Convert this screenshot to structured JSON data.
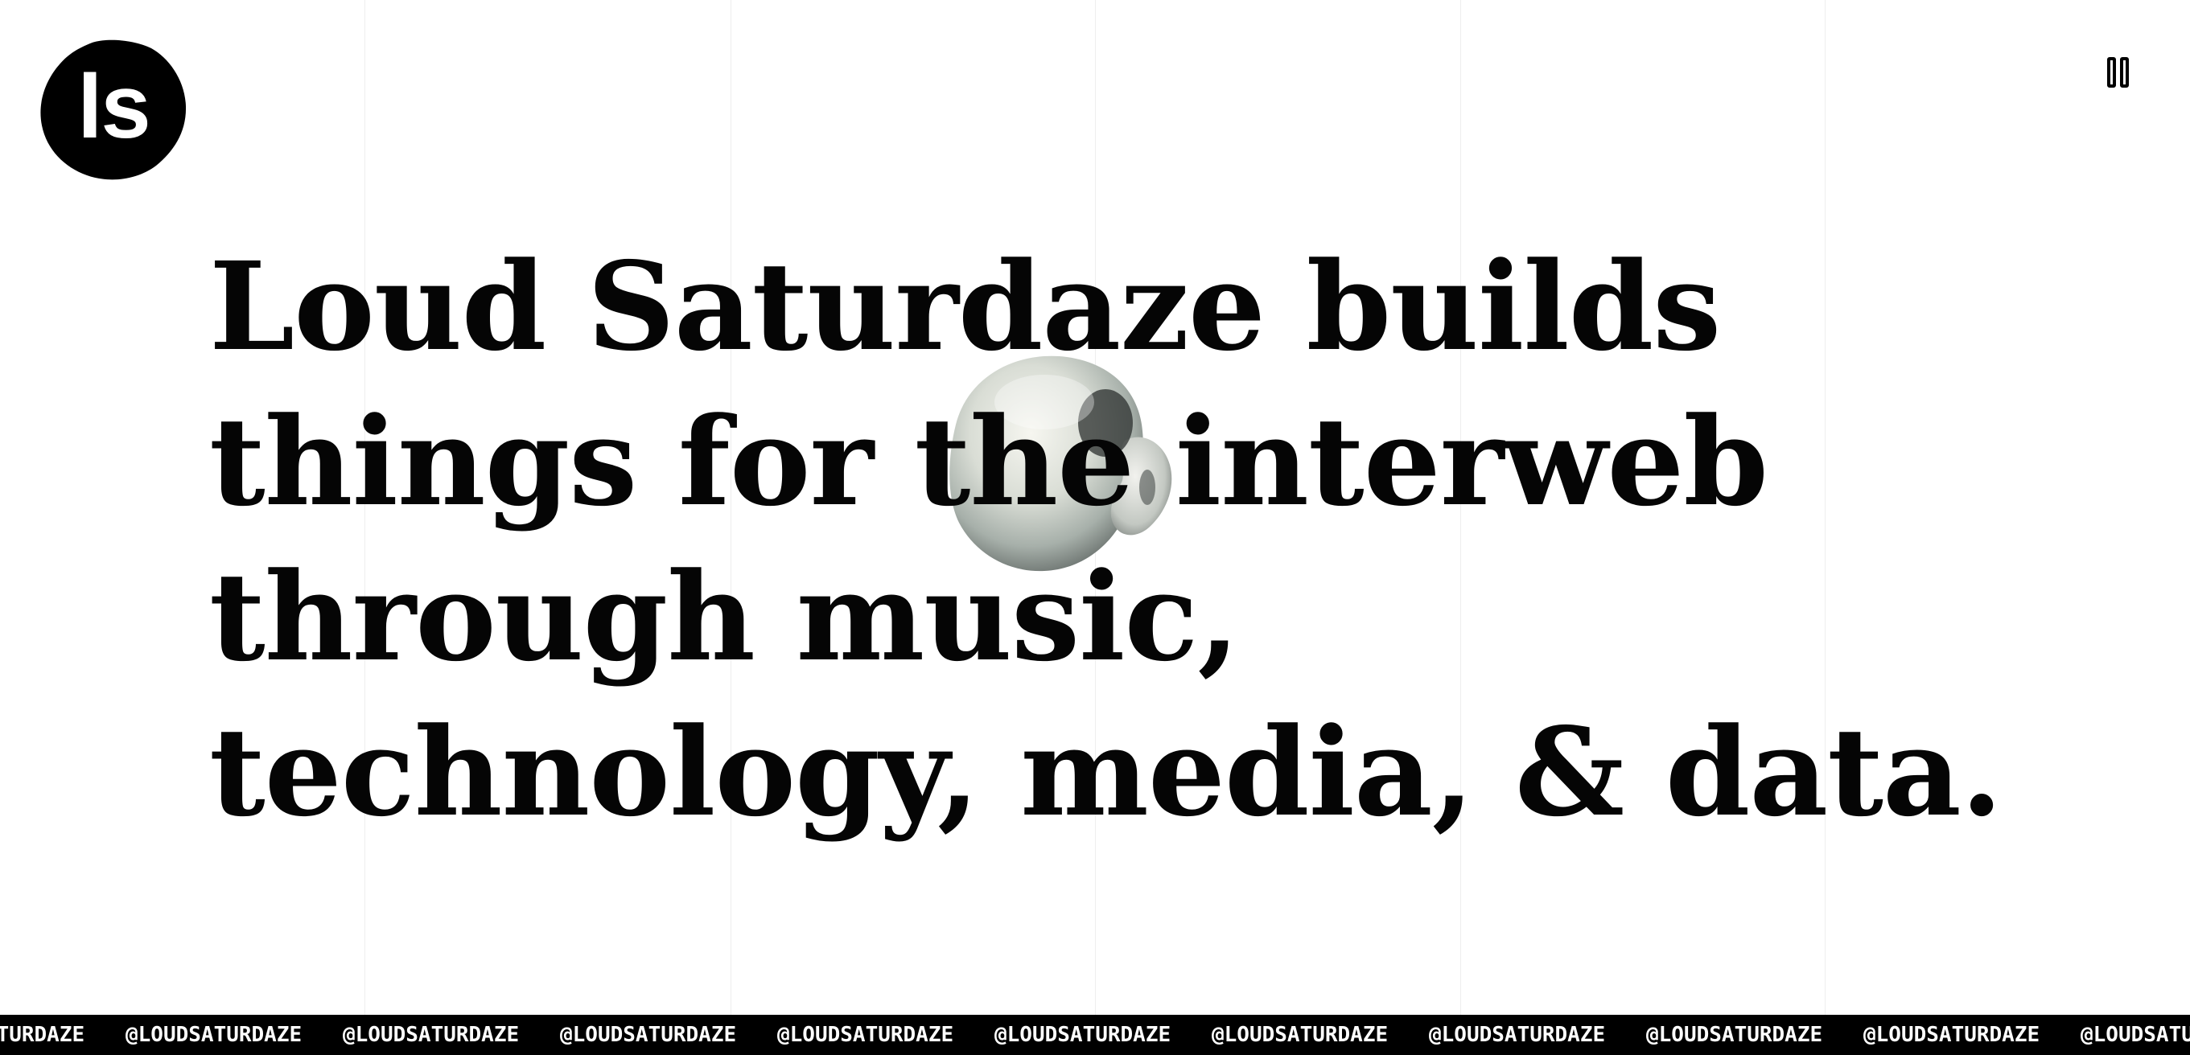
{
  "brand": {
    "logo_text": "ls",
    "logo_icon": "blob-logo-icon",
    "logo_color": "#000000"
  },
  "controls": {
    "pause_icon": "pause-icon"
  },
  "hero": {
    "headline": "Loud Saturdaze builds things for the interweb through music, technology, media, & data.",
    "image_icon": "skull-3d-icon"
  },
  "marquee": {
    "items": [
      "@LOUDSATURDAZE",
      "@LOUDSATURDAZE",
      "@LOUDSATURDAZE",
      "@LOUDSATURDAZE",
      "@LOUDSATURDAZE",
      "@LOUDSATURDAZE",
      "@LOUDSATURDAZE",
      "@LOUDSATURDAZE",
      "@LOUDSATURDAZE",
      "@LOUDSATURDAZE",
      "@LOUDSATURDAZE"
    ],
    "background_color": "#000000",
    "text_color": "#ffffff"
  },
  "colors": {
    "background": "#ffffff",
    "text": "#050505",
    "grid": "#eeeeee"
  }
}
